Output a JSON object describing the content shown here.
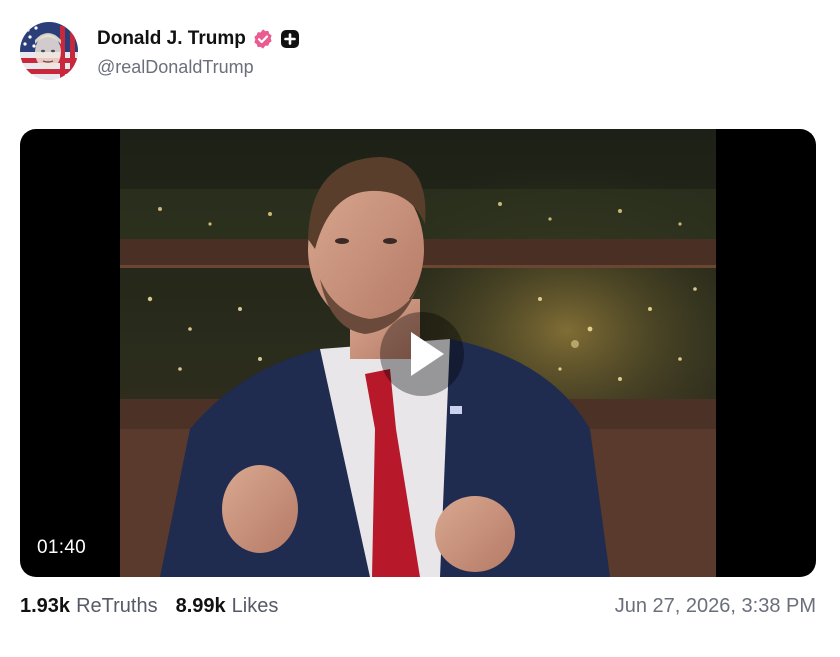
{
  "author": {
    "display_name": "Donald J. Trump",
    "handle": "@realDonaldTrump",
    "verified_icon": "verified-badge-icon",
    "plus_icon": "plus-badge-icon"
  },
  "media": {
    "duration": "01:40",
    "play_icon": "play-icon"
  },
  "stats": {
    "retruths_count": "1.93k",
    "retruths_label": "ReTruths",
    "likes_count": "8.99k",
    "likes_label": "Likes"
  },
  "timestamp": "Jun 27, 2026, 3:38 PM",
  "colors": {
    "verified_badge": "#e85c91",
    "suit": "#1f2b4f",
    "tie": "#b7182a",
    "letterbox": "#000000"
  }
}
